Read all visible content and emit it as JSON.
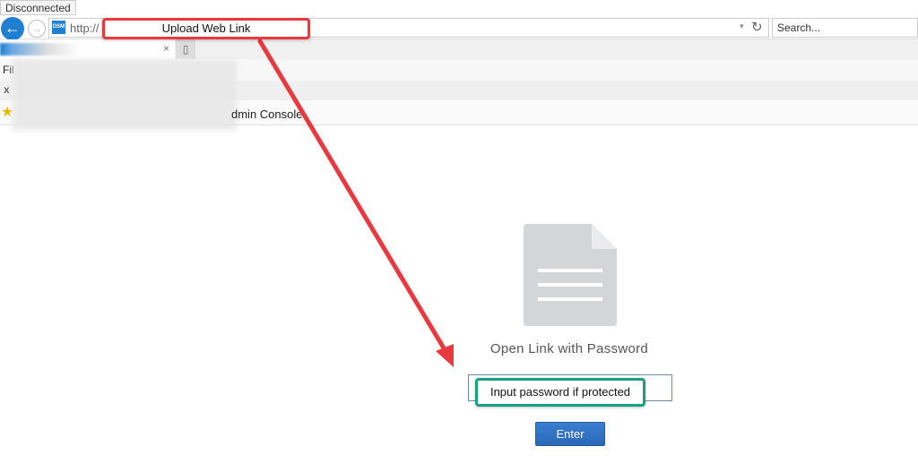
{
  "browser": {
    "status_text": "Disconnected",
    "url_prefix": "http://",
    "search_placeholder": "Search...",
    "menu_partial": "Fil",
    "notification_close": "x",
    "favorite_partial": "dmin Console",
    "back_icon": "←",
    "forward_icon": "→",
    "favicon_label": "DSM",
    "tab_close": "×",
    "refresh_icon": "↻",
    "dropdown_icon": "▾",
    "star_icon": "★"
  },
  "page": {
    "title": "Open Link with Password",
    "password_value": "",
    "enter_label": "Enter"
  },
  "annotations": {
    "top": "Upload Web Link",
    "bottom": "Input password if protected",
    "top_color": "#e8393e",
    "bottom_color": "#18a085"
  }
}
